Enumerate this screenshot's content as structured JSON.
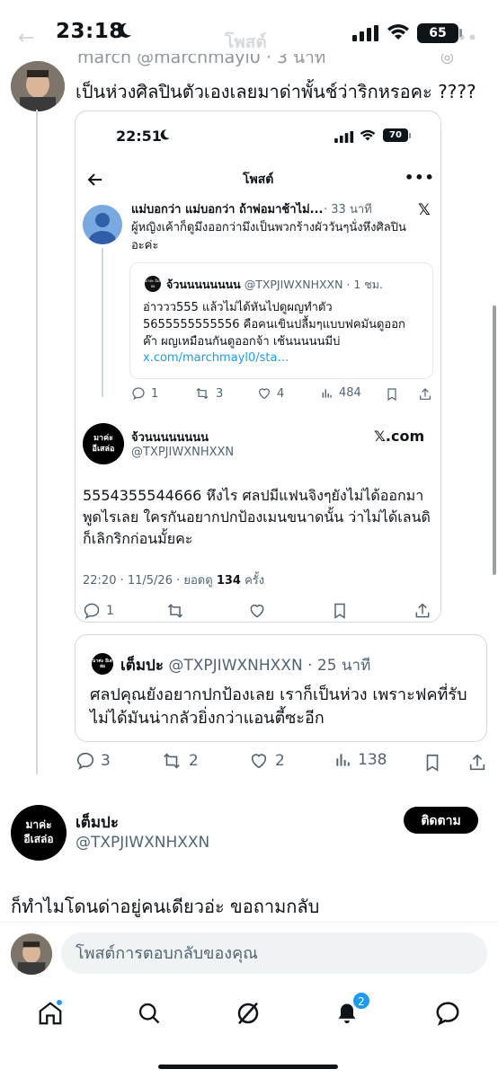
{
  "status_bar": {
    "time": "23:18",
    "battery": "65"
  },
  "header_ghost": {
    "title": "โพสต์"
  },
  "parent_tweet": {
    "name_cut": "march",
    "handle_cut": "@marchmayl0 · 3 นาที",
    "text": "เป็นห่วงศิลปินตัวเองเลยมาด่าพั้นช์ว่าริกหรอคะ ????"
  },
  "embedded_screenshot": {
    "time": "22:51",
    "battery": "70",
    "title": "โพสต์",
    "reply": {
      "name": "แม่บอกว่า แม่บอกว่า ถ้าพ่อมาช้าไม่...",
      "time": "· 33 นาที",
      "text": "ผู้หญิงเค้าก็ดูมึงออกว่ามึงเป็นพวกร้างผัววันๆนั่งหึงศิลปินอะค่ะ"
    },
    "quoted": {
      "name": "จ้วนนนนนนนน",
      "meta": "@TXPJIWXNHXXN · 1 ชม.",
      "text": "อ่าววว555 แล้วไม่ได้หันไปดูผญทำตัว 5655555555556 คือคนเขินปลื้มๆแบบฟคมันดูออกค๊า ผญเหมือนกันดูออกจ้า เช้นนนนนมีบ่",
      "link": "x.com/marchmayl0/sta…",
      "avatar_text": "มาค่ะ อีเสล่อ"
    },
    "actions1": {
      "replies": "1",
      "retweets": "3",
      "likes": "4",
      "views": "484"
    },
    "author": {
      "name": "จ้วนนนนนนนน",
      "handle": "@TXPJIWXNHXXN",
      "avatar_line1": "มาค่ะ",
      "avatar_line2": "อีเสล่อ",
      "xcom": "𝕏.com"
    },
    "body": "5554355544666 หึงไร ศลปมีแฟนจิงๆยังไม่ได้ออกมาพูดไรเลย ใครกันอยากปกป้องเมนขนาดนั้น ว่าไม่ได้เลนดิ ก็เลิกริกก่อนมั้ยคะ",
    "meta_prefix": "22:20 · 11/5/26 · ยอดดู",
    "meta_views": "134",
    "meta_suffix": "ครั้ง",
    "actions2": {
      "replies": "1"
    }
  },
  "quote_card": {
    "avatar_text": "มาค่ะ อีเสล่อ",
    "name": "เต็มปะ",
    "meta": "@TXPJIWXNHXXN · 25 นาที",
    "text": "ศลปคุณยังอยากปกป้องเลย เราก็เป็นห่วง เพราะฟคที่รับไม่ได้มันน่ากลัวยิ่งกว่าแอนตี้ซะอีก"
  },
  "parent_actions": {
    "replies": "3",
    "retweets": "2",
    "likes": "2",
    "views": "138"
  },
  "main_tweet": {
    "avatar_line1": "มาค่ะ",
    "avatar_line2": "อีเสล่อ",
    "name": "เต็มปะ",
    "handle": "@TXPJIWXNHXXN",
    "follow_label": "ติดตาม",
    "text": "ก็ทำไมโดนด่าอยู่คนเดียวอ่ะ ขอถามกลับ"
  },
  "reply_bar": {
    "placeholder": "โพสต์การตอบกลับของคุณ"
  },
  "tab_bar": {
    "notifications_badge": "2"
  },
  "colors": {
    "accent": "#1d9bf0",
    "text": "#0f1419",
    "muted": "#536471",
    "border": "#cfd9de"
  }
}
